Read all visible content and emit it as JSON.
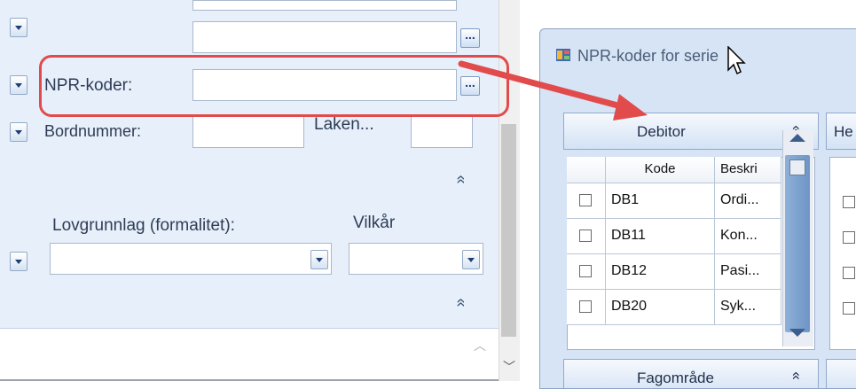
{
  "form": {
    "npr_label": "NPR-koder:",
    "bordnummer_label": "Bordnummer:",
    "laken_label": "Laken...",
    "lovgrunnlag_label": "Lovgrunnlag (formalitet):",
    "vilkar_label": "Vilkår",
    "ellipsis": "...",
    "collapse_glyph": "»"
  },
  "dialog": {
    "title": "NPR-koder for serie",
    "debitor_header": "Debitor",
    "next_header_partial": "He",
    "fagomrade_header": "Fagområde",
    "collapse_glyph": "»",
    "columns": [
      "Kode",
      "Beskri"
    ],
    "rows": [
      {
        "kode": "DB1",
        "beskrivelse": "Ordi..."
      },
      {
        "kode": "DB11",
        "beskrivelse": "Kon..."
      },
      {
        "kode": "DB12",
        "beskrivelse": "Pasi..."
      },
      {
        "kode": "DB20",
        "beskrivelse": "Syk..."
      }
    ]
  },
  "colors": {
    "highlight": "#e24b4b",
    "panel_bg": "#e7effa",
    "dialog_bg": "#d6e4f5"
  }
}
